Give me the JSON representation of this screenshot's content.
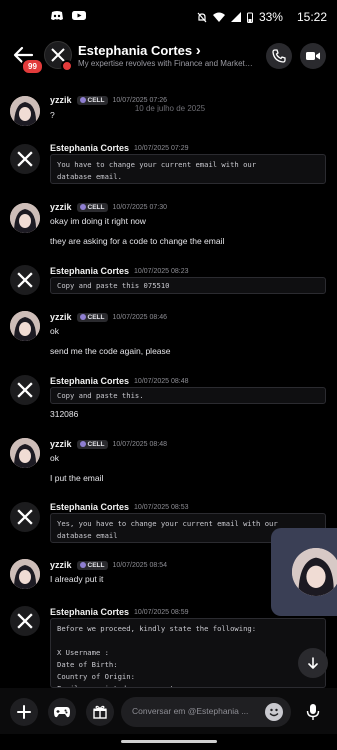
{
  "status": {
    "battery": "33%",
    "time": "15:22"
  },
  "header": {
    "unread_badge": "99",
    "name": "Estephania Cortes",
    "chevron": "›",
    "subtitle": "My expertise revolves with Finance and Marketin…",
    "date_divider": "10 de julho de 2025"
  },
  "messages": [
    {
      "author": "yzzik",
      "tag": "CELL",
      "time": "10/07/2025 07:26",
      "lines": [
        "?"
      ]
    },
    {
      "author": "Estephania Cortes",
      "time": "10/07/2025 07:29",
      "code": "You have to change your current email with our\ndatabase email."
    },
    {
      "author": "yzzik",
      "tag": "CELL",
      "time": "10/07/2025 07:30",
      "lines": [
        "okay im doing it right now",
        "they are asking for a code to change the email"
      ]
    },
    {
      "author": "Estephania Cortes",
      "time": "10/07/2025 08:23",
      "code": "Copy and paste this 075510"
    },
    {
      "author": "yzzik",
      "tag": "CELL",
      "time": "10/07/2025 08:46",
      "lines": [
        "ok",
        "send me the code again, please"
      ]
    },
    {
      "author": "Estephania Cortes",
      "time": "10/07/2025 08:48",
      "code": "Copy and paste this.",
      "after": "312086"
    },
    {
      "author": "yzzik",
      "tag": "CELL",
      "time": "10/07/2025 08:48",
      "lines": [
        "ok",
        "I put the email"
      ]
    },
    {
      "author": "Estephania Cortes",
      "time": "10/07/2025 08:53",
      "code": "Yes, you have to change your current email with our\ndatabase email"
    },
    {
      "author": "yzzik",
      "tag": "CELL",
      "time": "10/07/2025 08:54",
      "lines": [
        "I already put it"
      ]
    },
    {
      "author": "Estephania Cortes",
      "time": "10/07/2025 08:59",
      "code": "Before we proceed, kindly state the following:\n\nX Username :\nDate of Birth:\nCountry of Origin:\nEmail associated on account:"
    }
  ],
  "composer": {
    "placeholder": "Conversar em @Estephania ..."
  },
  "icons": [
    "back-arrow-icon",
    "x-logo-icon",
    "call-icon",
    "video-icon",
    "plus-icon",
    "gamepad-icon",
    "gift-icon",
    "emoji-icon",
    "mic-icon",
    "arrow-down-icon"
  ]
}
